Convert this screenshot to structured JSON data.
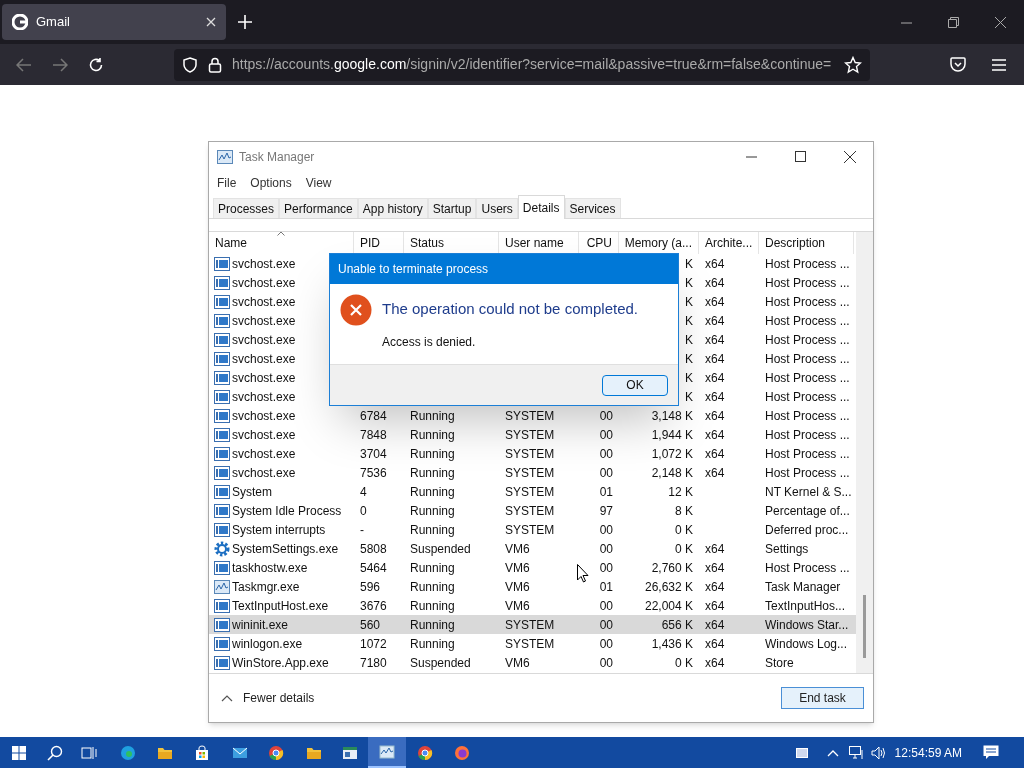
{
  "browser": {
    "tab": {
      "title": "Gmail"
    },
    "url": {
      "prefix": "https://accounts.",
      "domain": "google.com",
      "rest": "/signin/v2/identifier?service=mail&passive=true&rm=false&continue="
    }
  },
  "task_manager": {
    "title": "Task Manager",
    "menu": [
      "File",
      "Options",
      "View"
    ],
    "tabs": [
      {
        "label": "Processes",
        "selected": false
      },
      {
        "label": "Performance",
        "selected": false
      },
      {
        "label": "App history",
        "selected": false
      },
      {
        "label": "Startup",
        "selected": false
      },
      {
        "label": "Users",
        "selected": false
      },
      {
        "label": "Details",
        "selected": true
      },
      {
        "label": "Services",
        "selected": false
      }
    ],
    "columns": [
      "Name",
      "PID",
      "Status",
      "User name",
      "CPU",
      "Memory (a...",
      "Archite...",
      "Description"
    ],
    "rows": [
      {
        "kind": "service",
        "name": "svchost.exe",
        "memory": "K",
        "arch": "x64",
        "description": "Host Process ...",
        "selected": false
      },
      {
        "kind": "service",
        "name": "svchost.exe",
        "memory": "K",
        "arch": "x64",
        "description": "Host Process ...",
        "selected": false
      },
      {
        "kind": "service",
        "name": "svchost.exe",
        "memory": "K",
        "arch": "x64",
        "description": "Host Process ...",
        "selected": false
      },
      {
        "kind": "service",
        "name": "svchost.exe",
        "memory": "K",
        "arch": "x64",
        "description": "Host Process ...",
        "selected": false
      },
      {
        "kind": "service",
        "name": "svchost.exe",
        "memory": "K",
        "arch": "x64",
        "description": "Host Process ...",
        "selected": false
      },
      {
        "kind": "service",
        "name": "svchost.exe",
        "memory": "K",
        "arch": "x64",
        "description": "Host Process ...",
        "selected": false
      },
      {
        "kind": "service",
        "name": "svchost.exe",
        "memory": "K",
        "arch": "x64",
        "description": "Host Process ...",
        "selected": false
      },
      {
        "kind": "service",
        "name": "svchost.exe",
        "memory": "K",
        "arch": "x64",
        "description": "Host Process ...",
        "selected": false
      },
      {
        "kind": "service",
        "name": "svchost.exe",
        "pid": "6784",
        "status": "Running",
        "user": "SYSTEM",
        "cpu": "00",
        "memory": "3,148 K",
        "arch": "x64",
        "description": "Host Process ...",
        "selected": false
      },
      {
        "kind": "service",
        "name": "svchost.exe",
        "pid": "7848",
        "status": "Running",
        "user": "SYSTEM",
        "cpu": "00",
        "memory": "1,944 K",
        "arch": "x64",
        "description": "Host Process ...",
        "selected": false
      },
      {
        "kind": "service",
        "name": "svchost.exe",
        "pid": "3704",
        "status": "Running",
        "user": "SYSTEM",
        "cpu": "00",
        "memory": "1,072 K",
        "arch": "x64",
        "description": "Host Process ...",
        "selected": false
      },
      {
        "kind": "service",
        "name": "svchost.exe",
        "pid": "7536",
        "status": "Running",
        "user": "SYSTEM",
        "cpu": "00",
        "memory": "2,148 K",
        "arch": "x64",
        "description": "Host Process ...",
        "selected": false
      },
      {
        "kind": "service",
        "name": "System",
        "pid": "4",
        "status": "Running",
        "user": "SYSTEM",
        "cpu": "01",
        "memory": "12 K",
        "description": "NT Kernel & S...",
        "selected": false
      },
      {
        "kind": "service",
        "name": "System Idle Process",
        "pid": "0",
        "status": "Running",
        "user": "SYSTEM",
        "cpu": "97",
        "memory": "8 K",
        "description": "Percentage of...",
        "selected": false
      },
      {
        "kind": "service",
        "name": "System interrupts",
        "pid": "-",
        "status": "Running",
        "user": "SYSTEM",
        "cpu": "00",
        "memory": "0 K",
        "description": "Deferred proc...",
        "selected": false
      },
      {
        "kind": "settings",
        "name": "SystemSettings.exe",
        "pid": "5808",
        "status": "Suspended",
        "user": "VM6",
        "cpu": "00",
        "memory": "0 K",
        "arch": "x64",
        "description": "Settings",
        "selected": false
      },
      {
        "kind": "service",
        "name": "taskhostw.exe",
        "pid": "5464",
        "status": "Running",
        "user": "VM6",
        "cpu": "00",
        "memory": "2,760 K",
        "arch": "x64",
        "description": "Host Process ...",
        "selected": false
      },
      {
        "kind": "monitor",
        "name": "Taskmgr.exe",
        "pid": "596",
        "status": "Running",
        "user": "VM6",
        "cpu": "01",
        "memory": "26,632 K",
        "arch": "x64",
        "description": "Task Manager",
        "selected": false
      },
      {
        "kind": "service",
        "name": "TextInputHost.exe",
        "pid": "3676",
        "status": "Running",
        "user": "VM6",
        "cpu": "00",
        "memory": "22,004 K",
        "arch": "x64",
        "description": "TextInputHos...",
        "selected": false
      },
      {
        "kind": "service",
        "name": "wininit.exe",
        "pid": "560",
        "status": "Running",
        "user": "SYSTEM",
        "cpu": "00",
        "memory": "656 K",
        "arch": "x64",
        "description": "Windows Star...",
        "selected": true
      },
      {
        "kind": "service",
        "name": "winlogon.exe",
        "pid": "1072",
        "status": "Running",
        "user": "SYSTEM",
        "cpu": "00",
        "memory": "1,436 K",
        "arch": "x64",
        "description": "Windows Log...",
        "selected": false
      },
      {
        "kind": "service",
        "name": "WinStore.App.exe",
        "pid": "7180",
        "status": "Suspended",
        "user": "VM6",
        "cpu": "00",
        "memory": "0 K",
        "arch": "x64",
        "description": "Store",
        "selected": false
      }
    ],
    "fewer_details": "Fewer details",
    "end_task": "End task"
  },
  "dialog": {
    "title": "Unable to terminate process",
    "heading": "The operation could not be completed.",
    "message": "Access is denied.",
    "ok": "OK"
  },
  "taskbar": {
    "clock": "12:54:59 AM"
  }
}
